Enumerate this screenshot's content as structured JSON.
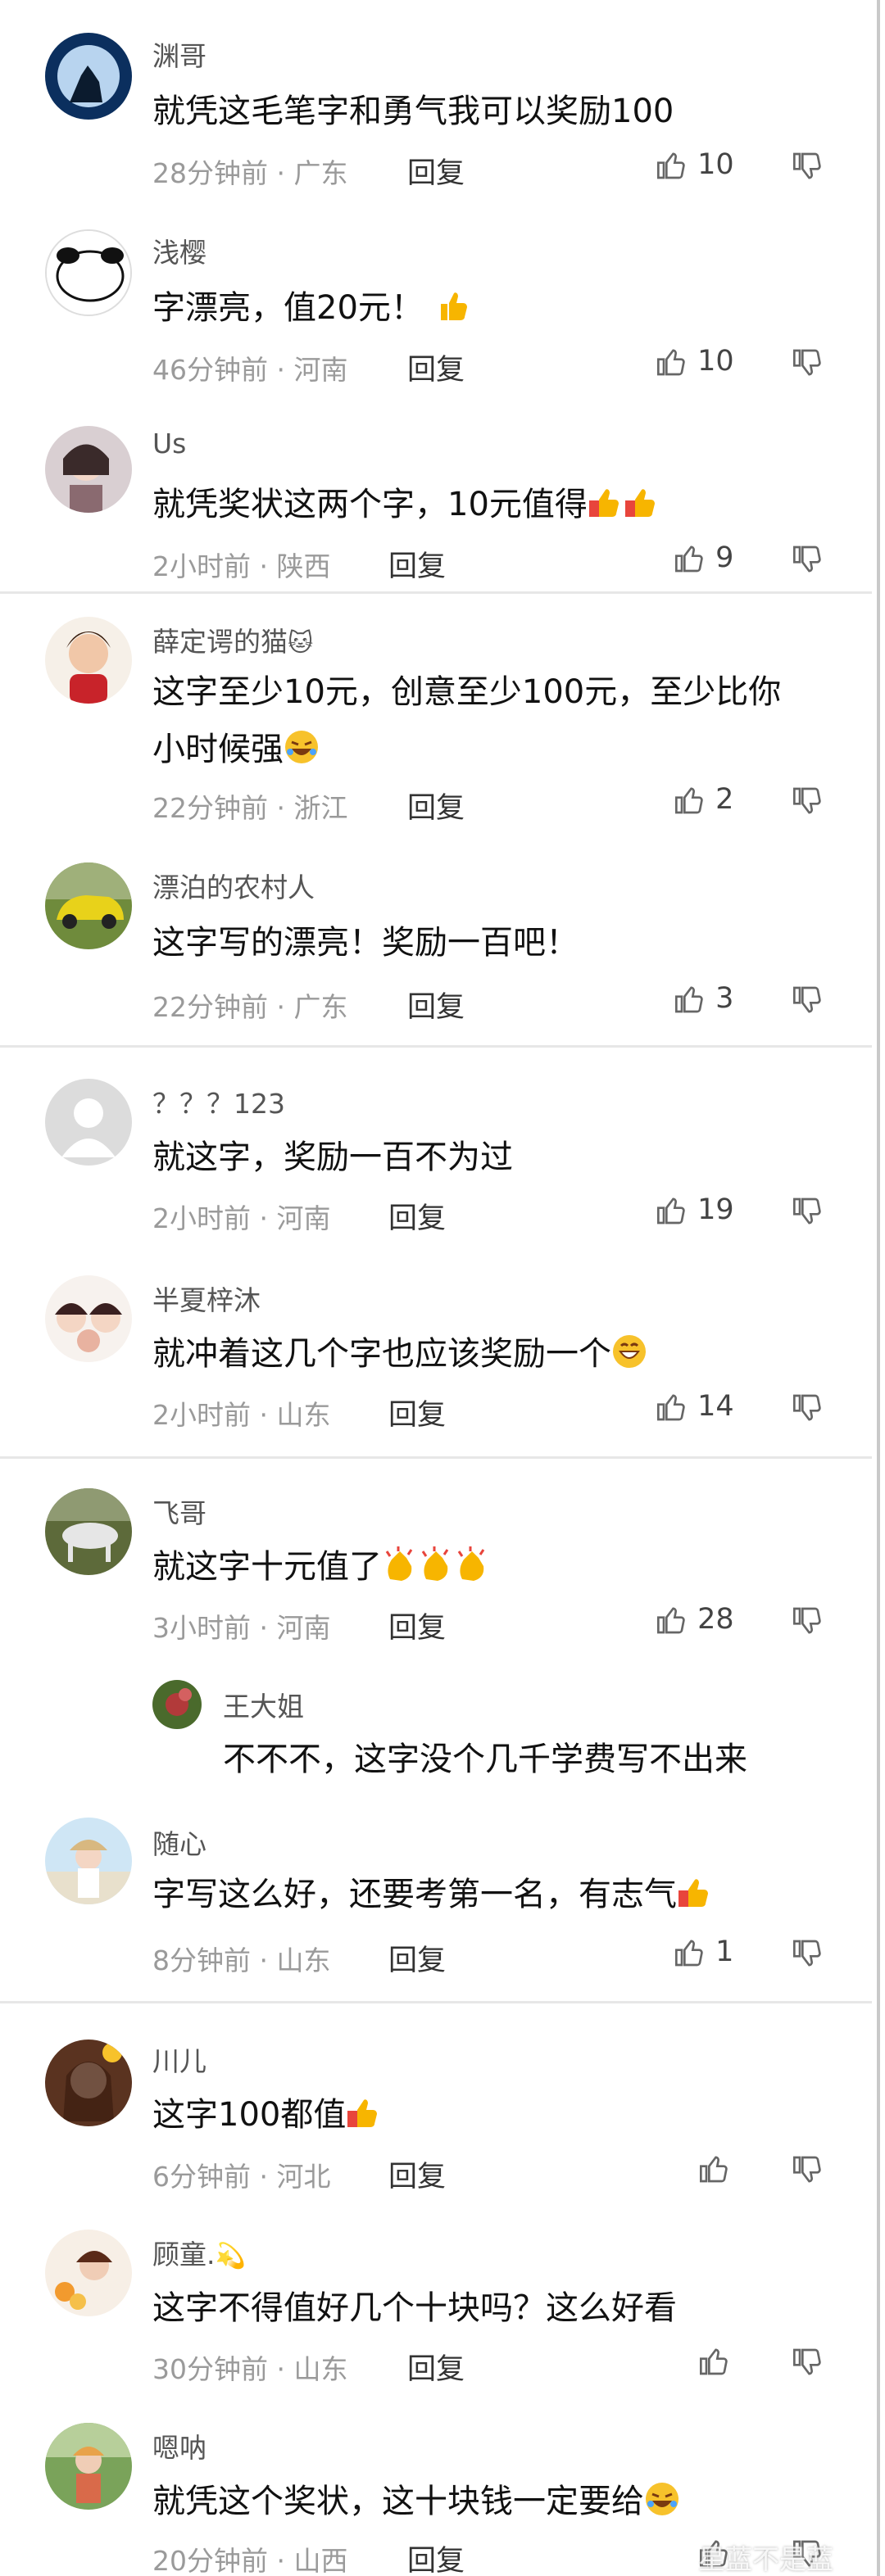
{
  "actions": {
    "reply_label": "回复"
  },
  "comments": [
    {
      "user": "渊哥",
      "text": "就凭这毛笔字和勇气我可以奖励100",
      "time": "28分钟前",
      "region": "广东",
      "likes": "10",
      "avatar": "wolf-moon-avatar"
    },
    {
      "user": "浅樱",
      "text": "字漂亮，值20元！",
      "time": "46分钟前",
      "region": "河南",
      "likes": "10",
      "avatar": "panda-avatar"
    },
    {
      "user": "Us",
      "text": "就凭奖状这两个字，10元值得",
      "time": "2小时前",
      "region": "陕西",
      "likes": "9",
      "avatar": "girl-avatar"
    },
    {
      "user": "薛定谔的猫",
      "text_line1": "这字至少10元，创意至少100元，至少比你",
      "text_line2": "小时候强",
      "time": "22分钟前",
      "region": "浙江",
      "likes": "2",
      "avatar": "cartoon-avatar"
    },
    {
      "user": "漂泊的农村人",
      "text": "这字写的漂亮！奖励一百吧！",
      "time": "22分钟前",
      "region": "广东",
      "likes": "3",
      "avatar": "car-avatar"
    },
    {
      "user": "？？？123",
      "text": "就这字，奖励一百不为过",
      "time": "2小时前",
      "region": "河南",
      "likes": "19",
      "avatar": "default-avatar"
    },
    {
      "user": "半夏梓沐",
      "text": "就冲着这几个字也应该奖励一个",
      "time": "2小时前",
      "region": "山东",
      "likes": "14",
      "avatar": "cartoon-girls-avatar"
    },
    {
      "user": "飞哥",
      "text": "就这字十元值了",
      "time": "3小时前",
      "region": "河南",
      "likes": "28",
      "avatar": "horse-avatar",
      "sub_reply": {
        "user": "王大姐",
        "text": "不不不，这字没个几千学费写不出来"
      }
    },
    {
      "user": "随心",
      "text": "字写这么好，还要考第一名，有志气",
      "time": "8分钟前",
      "region": "山东",
      "likes": "1",
      "avatar": "beach-avatar"
    },
    {
      "user": "川儿",
      "text": "这字100都值",
      "time": "6分钟前",
      "region": "河北",
      "likes": "",
      "avatar": "woman-avatar"
    },
    {
      "user": "顾童.",
      "text": "这字不得值好几个十块吗？这么好看",
      "time": "30分钟前",
      "region": "山东",
      "likes": "",
      "avatar": "flower-avatar"
    },
    {
      "user": "嗯呐",
      "text": "就凭这个奖状，这十块钱一定要给",
      "time": "20分钟前",
      "region": "山西",
      "likes": "",
      "avatar": "child-avatar"
    }
  ],
  "watermark": "星蓝不是蓝",
  "colors": {
    "thumbs_up": "#f7b500",
    "thumbs_red": "#e8453c",
    "meta_gray": "#9a9a9a"
  }
}
